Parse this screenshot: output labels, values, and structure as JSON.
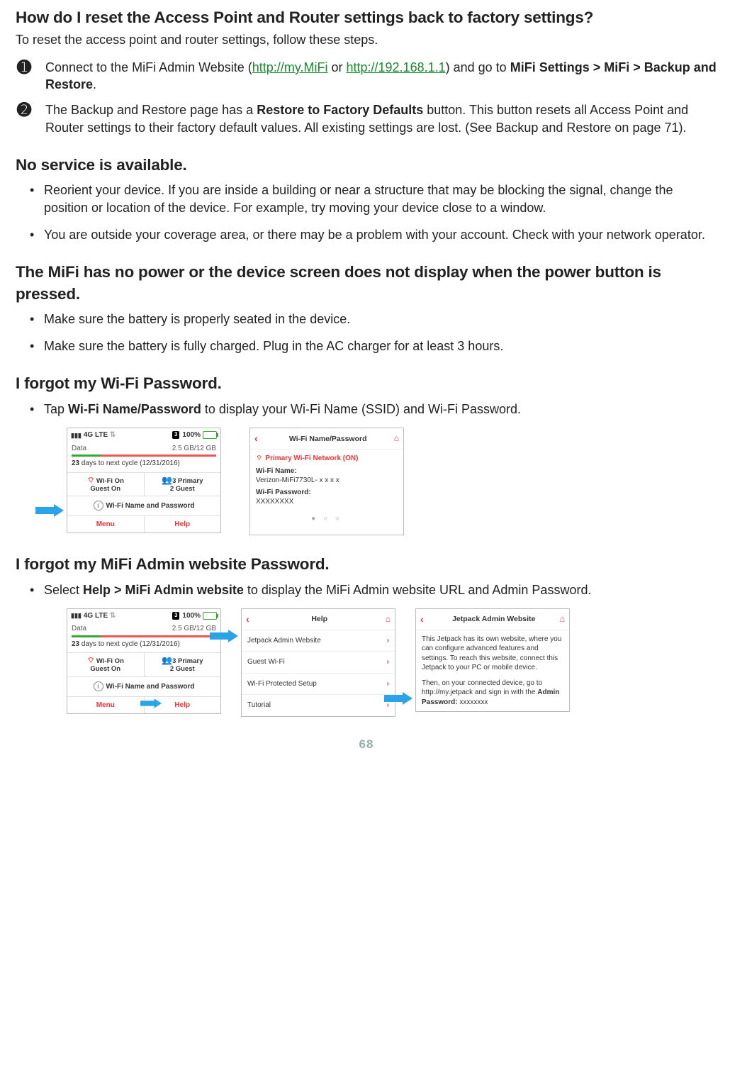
{
  "page_number": "68",
  "section1": {
    "heading": "How do I reset the Access Point and Router settings back to factory settings?",
    "intro": "To reset the access point and router settings, follow these steps.",
    "step1_pre": "Connect to the MiFi Admin Website (",
    "link1": "http://my.MiFi",
    "or": " or ",
    "link2": "http://192.168.1.1",
    "step1_post1": ")  and go to ",
    "step1_bold": "MiFi Settings > MiFi > Backup and Restore",
    "step1_post2": ".",
    "step2_pre": "The Backup and Restore page has a ",
    "step2_bold": "Restore to Factory Defaults",
    "step2_post": " button. This button resets all Access Point and Router settings to their factory default values. All existing settings are lost. (See Backup and Restore on page 71)."
  },
  "section2": {
    "heading": "No service is available.",
    "b1": "Reorient your device. If you are inside a building or near a structure that may be blocking the signal, change the position or location of the device. For example, try moving your device close to a window.",
    "b2": "You are outside your coverage area, or there may be a problem with your account. Check with your network operator."
  },
  "section3": {
    "heading": "The MiFi has no power or the device screen does not display when the power button is pressed.",
    "b1": "Make sure the battery is properly seated in the device.",
    "b2": "Make sure the battery is fully charged. Plug in the AC charger for at least 3 hours."
  },
  "section4": {
    "heading": "I forgot my Wi-Fi Password.",
    "b1_pre": "Tap ",
    "b1_bold": "Wi-Fi Name/Password",
    "b1_post": " to display your Wi-Fi Name (SSID) and Wi-Fi Password."
  },
  "section5": {
    "heading": "I forgot my MiFi Admin website Password.",
    "b1_pre": "Select ",
    "b1_bold": "Help > MiFi Admin website",
    "b1_post": " to display the MiFi Admin website URL and  Admin Password."
  },
  "device": {
    "network": "4G LTE",
    "msg_count": "3",
    "battery_pct": "100%",
    "data_label": "Data",
    "data_usage": "2.5 GB/12 GB",
    "cycle_bold": "23",
    "cycle_rest": " days to next cycle (12/31/2016)",
    "wifi_on": "Wi-Fi  On",
    "guest_on": "Guest On",
    "primary": "3 Primary",
    "guest_ct": "2 Guest",
    "namepw": "Wi-Fi Name and Password",
    "menu": "Menu",
    "help": "Help"
  },
  "wifiDetail": {
    "title": "Wi-Fi Name/Password",
    "primary_on": "Primary Wi-Fi Network (ON)",
    "name_lbl": "Wi-Fi Name:",
    "name_val": "Verizon-MiFi7730L- x x x x",
    "pw_lbl": "Wi-Fi Password:",
    "pw_val": "XXXXXXXX",
    "dots": "● ○ ○"
  },
  "helpPanel": {
    "title": "Help",
    "r1": "Jetpack Admin Website",
    "r2": "Guest Wi-Fi",
    "r3": "Wi-Fi Protected Setup",
    "r4": "Tutorial"
  },
  "adminPanel": {
    "title": "Jetpack Admin Website",
    "p1": "This Jetpack has its own website, where you can configure advanced features and settings. To reach this website, connect this Jetpack to your PC or mobile device.",
    "p2a": "Then, on your connected device, go to http://my.jetpack and sign in with the ",
    "p2b": "Admin Password:",
    "p2c": "   xxxxxxxx"
  }
}
